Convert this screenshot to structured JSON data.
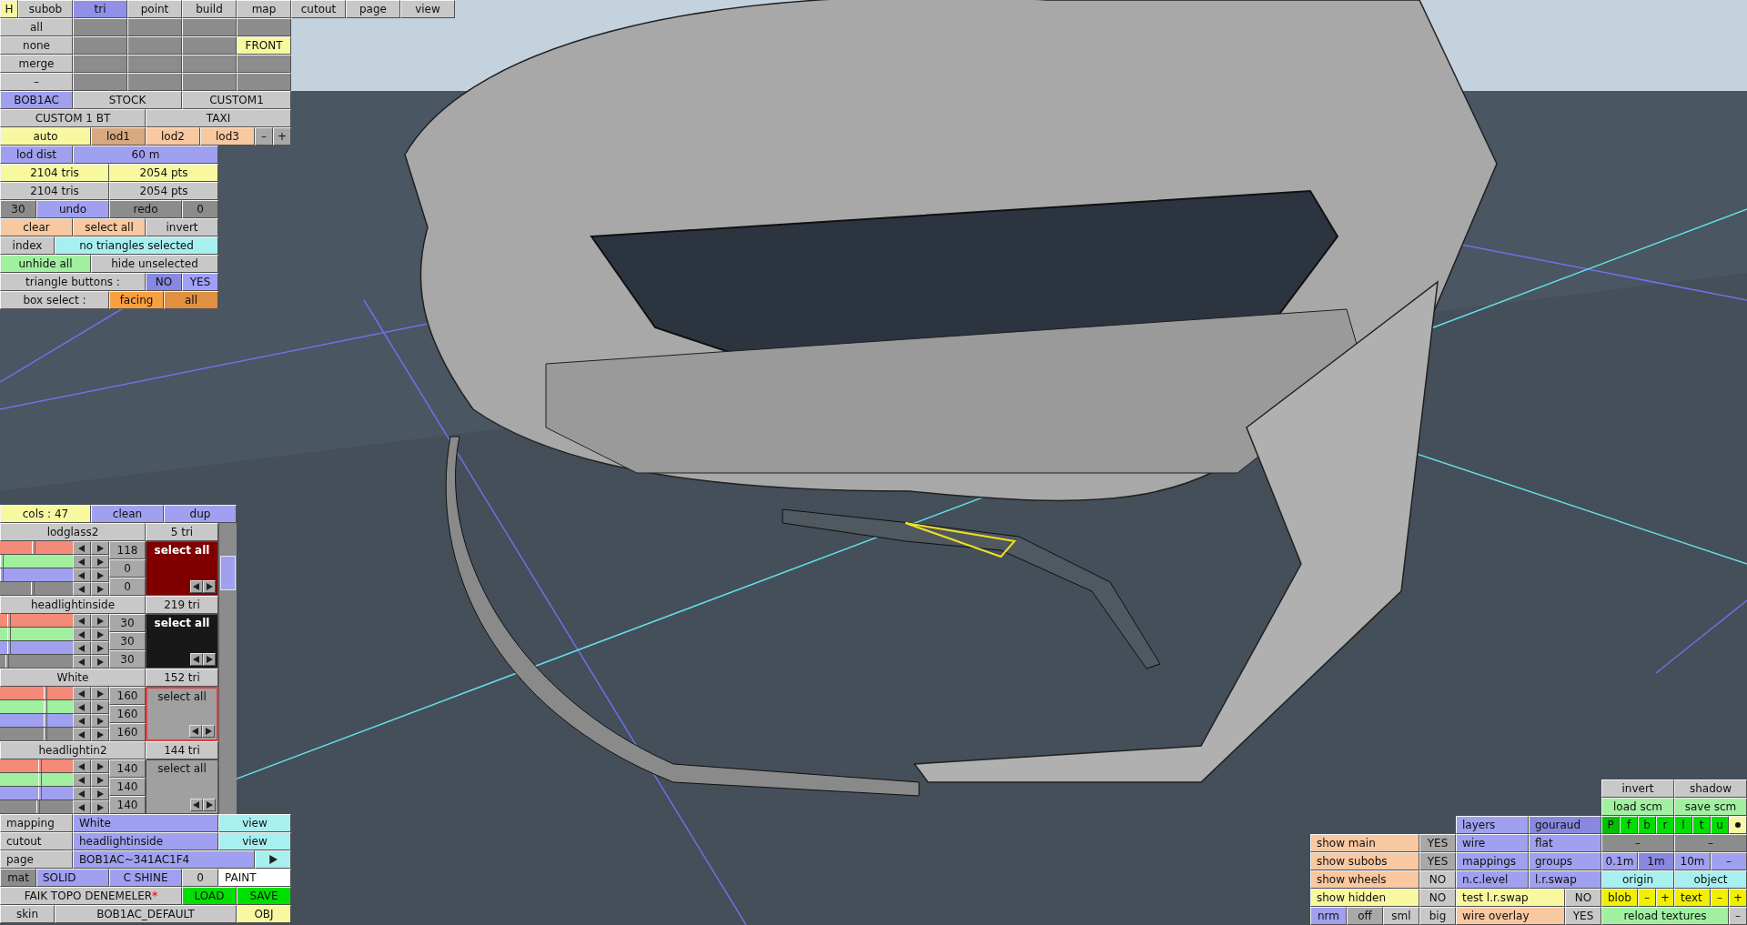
{
  "help_button": {
    "text": "H",
    "color": "#f8f8a0"
  },
  "mode_tabs": [
    {
      "label": "subob",
      "selected": false
    },
    {
      "label": "tri",
      "selected": true
    },
    {
      "label": "point",
      "selected": false
    },
    {
      "label": "build",
      "selected": false
    },
    {
      "label": "map",
      "selected": false
    },
    {
      "label": "cutout",
      "selected": false
    },
    {
      "label": "page",
      "selected": false
    },
    {
      "label": "view",
      "selected": false
    }
  ],
  "top_panel": [
    {
      "buttons": [
        {
          "text": "all",
          "color": "#c8c8c8"
        },
        {
          "color": "#8c8c8c"
        },
        {
          "color": "#8c8c8c"
        },
        {
          "color": "#8c8c8c"
        },
        {
          "color": "#8c8c8c"
        }
      ]
    },
    {
      "buttons": [
        {
          "text": "none",
          "color": "#c8c8c8"
        },
        {
          "color": "#8c8c8c"
        },
        {
          "color": "#8c8c8c"
        },
        {
          "color": "#8c8c8c"
        },
        {
          "text": "FRONT",
          "color": "#f8f8a0"
        }
      ]
    },
    {
      "buttons": [
        {
          "text": "merge",
          "color": "#c8c8c8"
        },
        {
          "color": "#8c8c8c"
        },
        {
          "color": "#8c8c8c"
        },
        {
          "color": "#8c8c8c"
        },
        {
          "color": "#8c8c8c"
        }
      ]
    },
    {
      "buttons": [
        {
          "text": "–",
          "color": "#c8c8c8"
        },
        {
          "color": "#8c8c8c"
        },
        {
          "color": "#8c8c8c"
        },
        {
          "color": "#8c8c8c"
        },
        {
          "color": "#8c8c8c"
        }
      ]
    },
    {
      "buttons": [
        {
          "text": "BOB1AC",
          "color": "#a0a0f0"
        },
        {
          "text": "STOCK",
          "color": "#c8c8c8"
        },
        {
          "text": "CUSTOM1",
          "color": "#c8c8c8"
        }
      ]
    },
    {
      "buttons": [
        {
          "text": "CUSTOM 1 BT",
          "color": "#c8c8c8"
        },
        {
          "text": "TAXI",
          "color": "#c8c8c8"
        }
      ]
    },
    {
      "buttons": [
        {
          "text": "auto",
          "color": "#f8f8a0"
        },
        {
          "text": "lod1",
          "color": "#d8a880"
        },
        {
          "text": "lod2",
          "color": "#f8c8a0"
        },
        {
          "text": "lod3",
          "color": "#f8c8a0"
        },
        {
          "text": "–",
          "color": "#a8a8a8"
        },
        {
          "text": "+",
          "color": "#a8a8a8"
        }
      ]
    },
    {
      "buttons": [
        {
          "text": "lod dist",
          "color": "#a0a0f0"
        },
        {
          "text": "60 m",
          "color": "#a0a0f0"
        }
      ]
    },
    {
      "buttons": [
        {
          "text": "2104 tris",
          "color": "#f8f8a0"
        },
        {
          "text": "2054 pts",
          "color": "#f8f8a0"
        }
      ]
    },
    {
      "buttons": [
        {
          "text": "2104 tris",
          "color": "#c8c8c8"
        },
        {
          "text": "2054 pts",
          "color": "#c8c8c8"
        }
      ]
    },
    {
      "buttons": [
        {
          "text": "30",
          "color": "#8c8c8c"
        },
        {
          "text": "undo",
          "color": "#a0a0f0"
        },
        {
          "text": "redo",
          "color": "#8c8c8c"
        },
        {
          "text": "0",
          "color": "#8c8c8c"
        }
      ]
    },
    {
      "buttons": [
        {
          "text": "clear",
          "color": "#f8c8a0"
        },
        {
          "text": "select all",
          "color": "#f8c8a0"
        },
        {
          "text": "invert",
          "color": "#c8c8c8"
        }
      ]
    },
    {
      "buttons": [
        {
          "text": "index",
          "color": "#c8c8c8"
        },
        {
          "text": "no triangles selected",
          "color": "#a8f0f0"
        }
      ]
    },
    {
      "buttons": [
        {
          "text": "unhide all",
          "color": "#a0f0a0"
        },
        {
          "text": "hide unselected",
          "color": "#c8c8c8"
        }
      ]
    },
    {
      "buttons": [
        {
          "text": "triangle buttons :",
          "color": "#c8c8c8"
        },
        {
          "text": "NO",
          "color": "#8888e0"
        },
        {
          "text": "YES",
          "color": "#a0a0f8"
        }
      ]
    },
    {
      "buttons": [
        {
          "text": "box select :",
          "color": "#c8c8c8"
        },
        {
          "text": "facing",
          "color": "#f8a040"
        },
        {
          "text": "all",
          "color": "#e09040"
        }
      ]
    }
  ],
  "materials": {
    "header": [
      {
        "text": "cols : 47",
        "color": "#f8f8a0"
      },
      {
        "text": "clean",
        "color": "#a0a0f0"
      },
      {
        "text": "dup",
        "color": "#a0a0f0"
      }
    ],
    "items": [
      {
        "name": "lodglass2",
        "tris": "5 tri",
        "sliders": [
          {
            "level": 0.46
          },
          {
            "level": 0
          },
          {
            "level": 0
          },
          {
            "level": 0.45
          }
        ],
        "values": [
          "118",
          "0",
          "0"
        ],
        "color": "#800000",
        "selected": false,
        "action": "select all"
      },
      {
        "name": "headlightinside",
        "tris": "219 tri",
        "sliders": [
          {
            "level": 0.12
          },
          {
            "level": 0.12
          },
          {
            "level": 0.12
          },
          {
            "level": 0.1
          }
        ],
        "values": [
          "30",
          "30",
          "30"
        ],
        "color": "#181818",
        "selected": false,
        "action": "select all"
      },
      {
        "name": "White",
        "tris": "152 tri",
        "sliders": [
          {
            "level": 0.63
          },
          {
            "level": 0.63
          },
          {
            "level": 0.63
          },
          {
            "level": 0.63
          }
        ],
        "values": [
          "160",
          "160",
          "160"
        ],
        "color": "#a0a0a0",
        "selected": true,
        "action": "select all"
      },
      {
        "name": "headlightin2",
        "tris": "144 tri",
        "sliders": [
          {
            "level": 0.55
          },
          {
            "level": 0.55
          },
          {
            "level": 0.55
          },
          {
            "level": 0.53
          }
        ],
        "values": [
          "140",
          "140",
          "140"
        ],
        "color": "#a0a0a0",
        "selected": false,
        "action": "select all"
      }
    ]
  },
  "bottom_left": [
    {
      "buttons": [
        {
          "text": "mapping",
          "color": "#c8c8c8"
        },
        {
          "text": "White",
          "color": "#a0a0f0"
        },
        {
          "text": "view",
          "color": "#a8f0f0"
        }
      ]
    },
    {
      "buttons": [
        {
          "text": "cutout",
          "color": "#c8c8c8"
        },
        {
          "text": "headlightinside",
          "color": "#a0a0f0"
        },
        {
          "text": "view",
          "color": "#a8f0f0"
        }
      ]
    },
    {
      "buttons": [
        {
          "text": "page",
          "color": "#c8c8c8"
        },
        {
          "text": "BOB1AC~341AC1F4",
          "color": "#a0a0f0"
        },
        {
          "kind": "arrow",
          "color": "#a8f0f0"
        }
      ]
    },
    {
      "buttons": [
        {
          "text": "mat",
          "color": "#8c8c8c"
        },
        {
          "text": "SOLID",
          "color": "#a0a0f0"
        },
        {
          "text": "C SHINE",
          "color": "#a0a0f0"
        },
        {
          "text": "0",
          "color": "#c8c8c8"
        },
        {
          "text": "PAINT",
          "color": "#ffffff"
        }
      ]
    },
    {
      "buttons": [
        {
          "text": "FAIK TOPO DENEMELER",
          "marker": "*",
          "color": "#c8c8c8"
        },
        {
          "text": "LOAD",
          "color": "#00e000"
        },
        {
          "text": "SAVE",
          "color": "#00e000"
        }
      ]
    },
    {
      "buttons": [
        {
          "text": "skin",
          "color": "#c8c8c8"
        },
        {
          "text": "BOB1AC_DEFAULT",
          "color": "#c8c8c8"
        },
        {
          "text": "OBJ",
          "color": "#f8f8a0"
        }
      ]
    }
  ],
  "bottom_right": [
    {
      "buttons": [
        {
          "text": "invert",
          "color": "#c8c8c8"
        },
        {
          "text": "shadow",
          "color": "#c8c8c8"
        }
      ]
    },
    {
      "buttons": [
        {
          "text": "load scm",
          "color": "#a0f0a0"
        },
        {
          "text": "save scm",
          "color": "#a0f0a0"
        }
      ]
    },
    {
      "buttons": [
        {
          "text": "layers",
          "color": "#a0a0f0"
        },
        {
          "text": "gouraud",
          "color": "#8888e0"
        },
        {
          "text": "P",
          "color": "#00c000"
        },
        {
          "text": "f",
          "color": "#00e000"
        },
        {
          "text": "b",
          "color": "#00e000"
        },
        {
          "text": "r",
          "color": "#00e000"
        },
        {
          "text": "l",
          "color": "#00e000"
        },
        {
          "text": "t",
          "color": "#00e000"
        },
        {
          "text": "u",
          "color": "#00e000"
        },
        {
          "kind": "dot",
          "color": "#f8f8a0"
        }
      ]
    },
    {
      "buttons": [
        {
          "text": "show main",
          "color": "#f8c8a0"
        },
        {
          "text": "YES",
          "color": "#a8a8a8"
        },
        {
          "text": "wire",
          "color": "#a0a0f0"
        },
        {
          "text": "flat",
          "color": "#a0a0f0"
        },
        {
          "text": "–",
          "color": "#8c8c8c"
        },
        {
          "text": "–",
          "color": "#8c8c8c"
        }
      ]
    },
    {
      "buttons": [
        {
          "text": "show subobs",
          "color": "#f8c8a0"
        },
        {
          "text": "YES",
          "color": "#a8a8a8"
        },
        {
          "text": "mappings",
          "color": "#a0a0f0"
        },
        {
          "text": "groups",
          "color": "#a0a0f0"
        },
        {
          "text": "0.1m",
          "color": "#a0a0f0"
        },
        {
          "text": "1m",
          "color": "#8888e0"
        },
        {
          "text": "10m",
          "color": "#a0a0f0"
        },
        {
          "text": "–",
          "color": "#a0a0f0"
        }
      ]
    },
    {
      "buttons": [
        {
          "text": "show wheels",
          "color": "#f8c8a0"
        },
        {
          "text": "NO",
          "color": "#c8c8c8"
        },
        {
          "text": "n.c.level",
          "color": "#a0a0f0"
        },
        {
          "text": "l.r.swap",
          "color": "#a0a0f0"
        },
        {
          "text": "origin",
          "color": "#a8f0f0"
        },
        {
          "text": "object",
          "color": "#a8f0f0"
        }
      ]
    },
    {
      "buttons": [
        {
          "text": "show hidden",
          "color": "#f8f8a0"
        },
        {
          "text": "NO",
          "color": "#c8c8c8"
        },
        {
          "text": "test l.r.swap",
          "color": "#f8f8a0"
        },
        {
          "text": "NO",
          "color": "#c8c8c8"
        },
        {
          "text": "blob",
          "color": "#f0f000"
        },
        {
          "text": "–",
          "color": "#f0f000"
        },
        {
          "text": "+",
          "color": "#f0f000"
        },
        {
          "text": "text",
          "color": "#f0f000"
        },
        {
          "text": "–",
          "color": "#f0f000"
        },
        {
          "text": "+",
          "color": "#f0f000"
        }
      ]
    },
    {
      "buttons": [
        {
          "text": "nrm",
          "color": "#a0a0f0"
        },
        {
          "text": "off",
          "color": "#a8a8a8"
        },
        {
          "text": "sml",
          "color": "#c8c8c8"
        },
        {
          "text": "big",
          "color": "#c8c8c8"
        },
        {
          "text": "wire overlay",
          "color": "#f8c8a0"
        },
        {
          "text": "YES",
          "color": "#c8c8c8"
        },
        {
          "text": "reload textures",
          "color": "#a0f0a0"
        },
        {
          "text": "–",
          "color": "#c8c8c8"
        }
      ]
    }
  ]
}
